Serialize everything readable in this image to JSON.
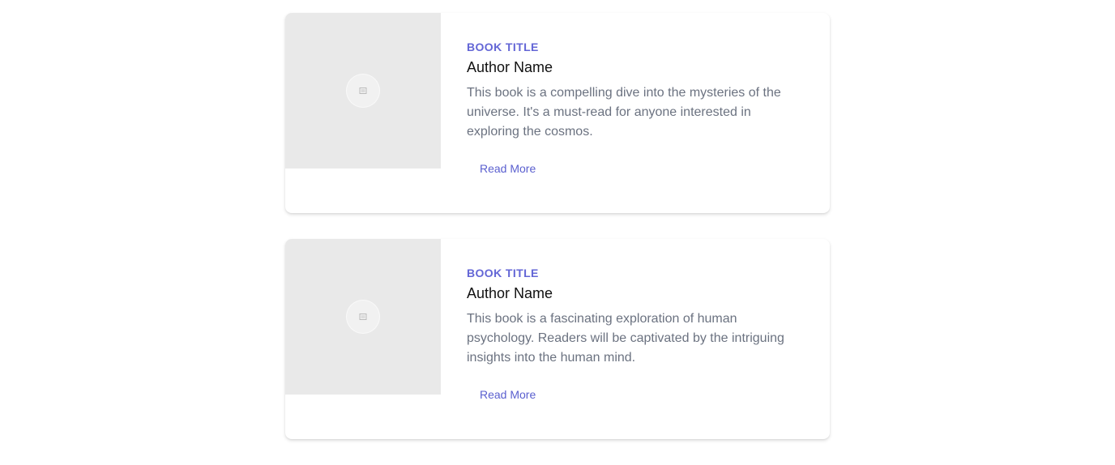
{
  "books": [
    {
      "title": "Book Title",
      "author": "Author Name",
      "description": "This book is a compelling dive into the mysteries of the universe. It's a must-read for anyone interested in exploring the cosmos.",
      "read_more_label": "Read More",
      "image_icon": "image-placeholder-icon"
    },
    {
      "title": "Book Title",
      "author": "Author Name",
      "description": "This book is a fascinating exploration of human psychology. Readers will be captivated by the intriguing insights into the human mind.",
      "read_more_label": "Read More",
      "image_icon": "image-placeholder-icon"
    }
  ],
  "colors": {
    "accent": "#6366d6",
    "link": "#5a5fcf",
    "description": "#6b7280",
    "placeholder_bg": "#e9e9e9"
  }
}
